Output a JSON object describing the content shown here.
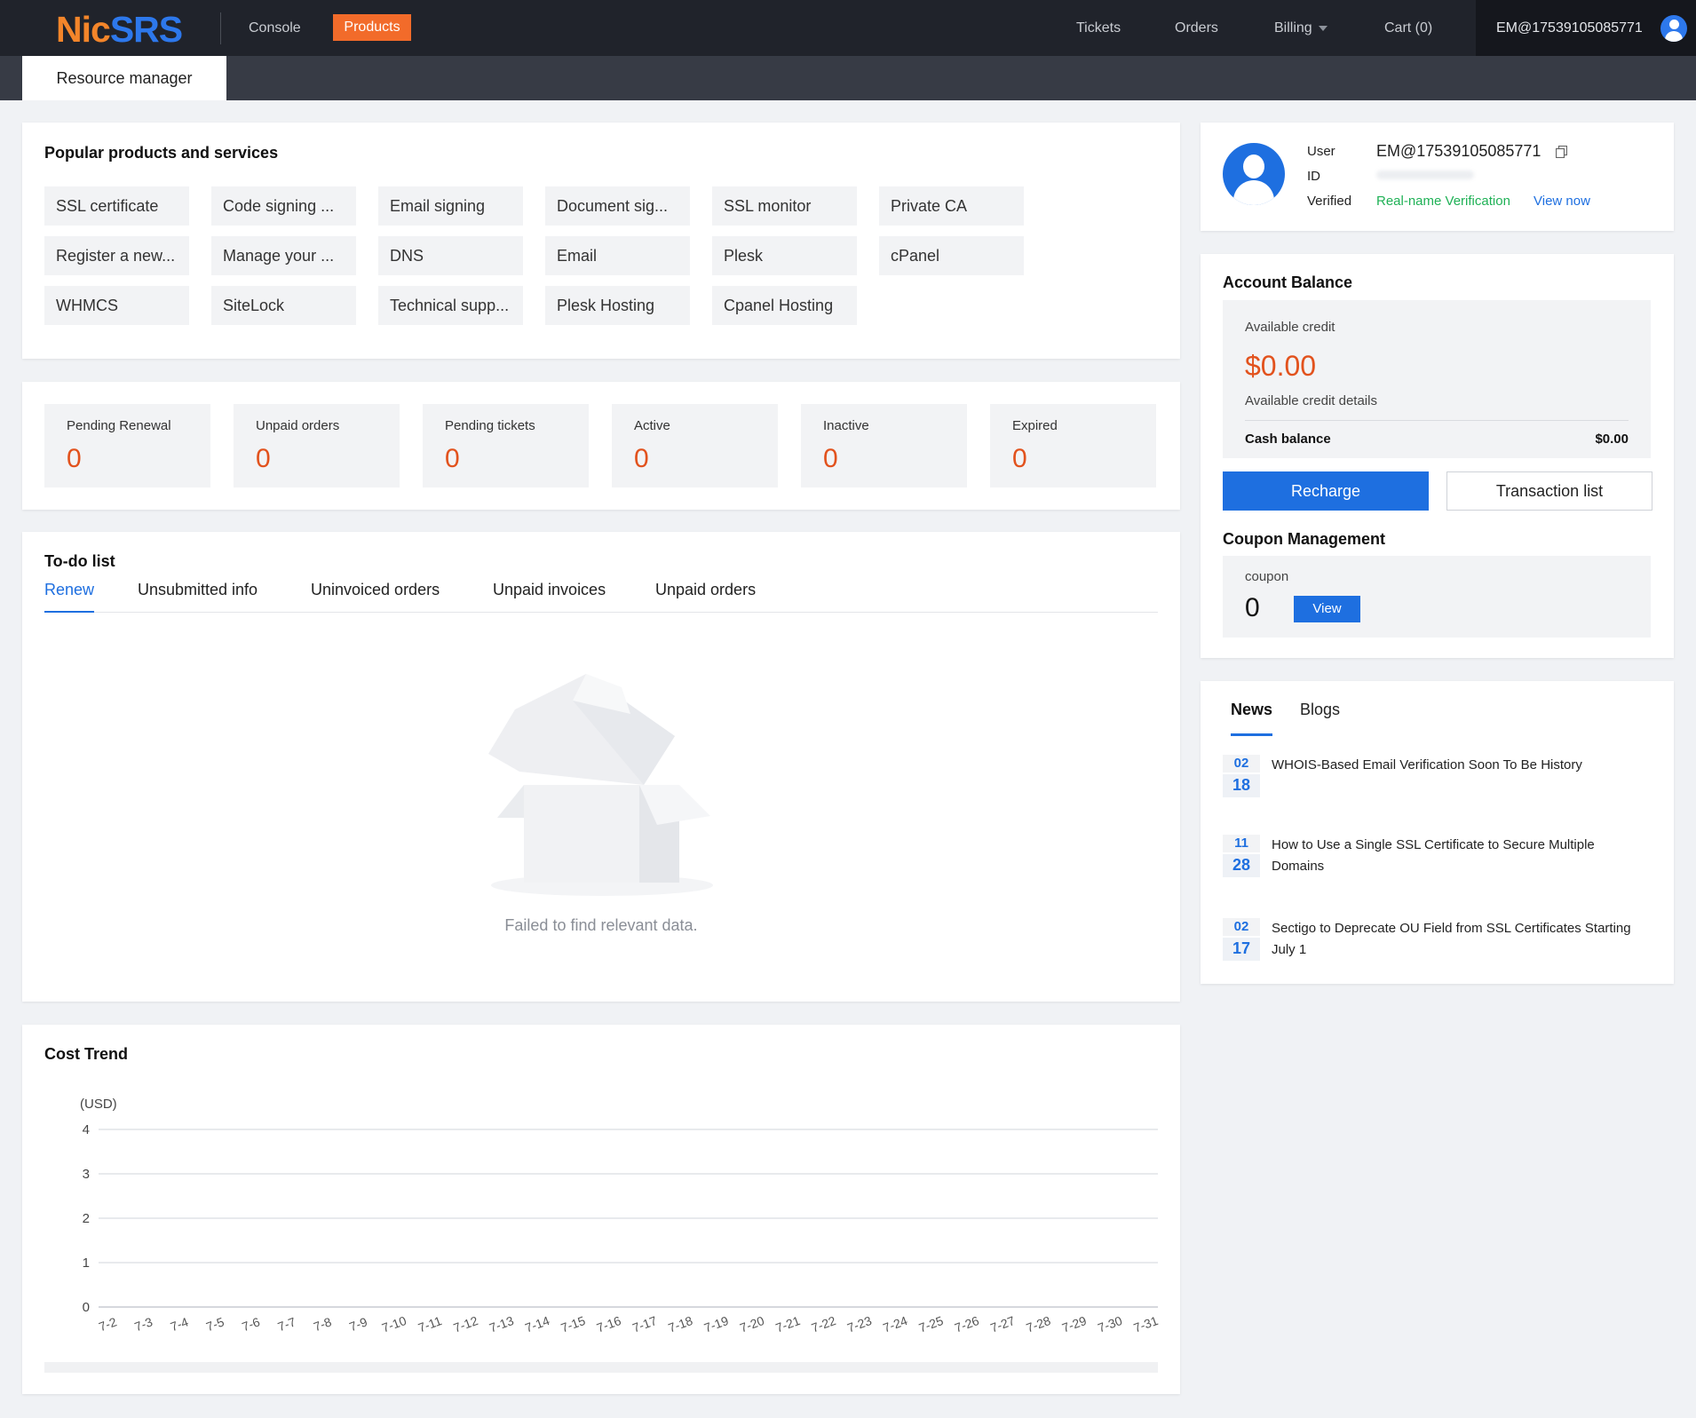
{
  "nav": {
    "logo_a": "Nic",
    "logo_b": "SRS",
    "console": "Console",
    "products": "Products",
    "tickets": "Tickets",
    "orders": "Orders",
    "billing": "Billing",
    "cart": "Cart (0)",
    "user_email": "EM@17539105085771"
  },
  "subnav": {
    "resource_manager": "Resource manager"
  },
  "popular": {
    "title": "Popular products and services",
    "items": [
      "SSL certificate",
      "Code signing ...",
      "Email signing",
      "Document sig...",
      "SSL monitor",
      "Private CA",
      "Register a new...",
      "Manage your ...",
      "DNS",
      "Email",
      "Plesk",
      "cPanel",
      "WHMCS",
      "SiteLock",
      "Technical supp...",
      "Plesk Hosting",
      "Cpanel Hosting"
    ]
  },
  "stats": [
    {
      "label": "Pending Renewal",
      "value": "0"
    },
    {
      "label": "Unpaid orders",
      "value": "0"
    },
    {
      "label": "Pending tickets",
      "value": "0"
    },
    {
      "label": "Active",
      "value": "0"
    },
    {
      "label": "Inactive",
      "value": "0"
    },
    {
      "label": "Expired",
      "value": "0"
    }
  ],
  "todo": {
    "title": "To-do list",
    "tabs": [
      "Renew",
      "Unsubmitted info",
      "Uninvoiced orders",
      "Unpaid invoices",
      "Unpaid orders"
    ],
    "active_tab": "Renew",
    "empty_text": "Failed to find relevant data."
  },
  "cost_trend": {
    "title": "Cost Trend"
  },
  "chart_data": {
    "type": "line",
    "title": "Cost Trend",
    "ylabel": "(USD)",
    "xlabel": "",
    "ylim": [
      0,
      4
    ],
    "yticks": [
      "0",
      "1",
      "2",
      "3",
      "4"
    ],
    "x": [
      "7-2",
      "7-3",
      "7-4",
      "7-5",
      "7-6",
      "7-7",
      "7-8",
      "7-9",
      "7-10",
      "7-11",
      "7-12",
      "7-13",
      "7-14",
      "7-15",
      "7-16",
      "7-17",
      "7-18",
      "7-19",
      "7-20",
      "7-21",
      "7-22",
      "7-23",
      "7-24",
      "7-25",
      "7-26",
      "7-27",
      "7-28",
      "7-29",
      "7-30",
      "7-31"
    ],
    "series": [],
    "grid": true
  },
  "profile": {
    "user_label": "User",
    "id_label": "ID",
    "verified_label": "Verified",
    "email": "EM@17539105085771",
    "verification": "Real-name Verification",
    "view_now": "View now"
  },
  "balance": {
    "title": "Account Balance",
    "available_credit_label": "Available credit",
    "available_credit": "$0.00",
    "available_credit_details": "Available credit details",
    "cash_balance_label": "Cash balance",
    "cash_balance": "$0.00",
    "recharge": "Recharge",
    "transaction_list": "Transaction list"
  },
  "coupon": {
    "title": "Coupon Management",
    "label": "coupon",
    "count": "0",
    "view": "View"
  },
  "news": {
    "tabs": [
      "News",
      "Blogs"
    ],
    "active_tab": "News",
    "items": [
      {
        "month": "02",
        "day": "18",
        "title": "WHOIS-Based Email Verification Soon To Be History"
      },
      {
        "month": "11",
        "day": "28",
        "title": "How to Use a Single SSL Certificate to Secure Multiple Domains"
      },
      {
        "month": "02",
        "day": "17",
        "title": "Sectigo to Deprecate OU Field from SSL Certificates Starting July 1"
      }
    ]
  },
  "colors": {
    "accent_blue": "#1e6fe0",
    "accent_orange": "#f26b2a",
    "value_orange": "#e2521d",
    "nav_bg": "#20232b"
  }
}
